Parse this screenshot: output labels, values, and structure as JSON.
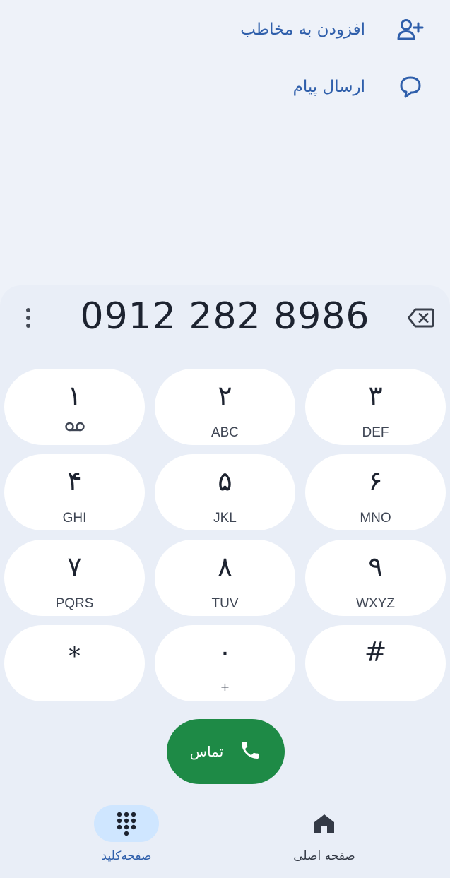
{
  "actions": {
    "add_contact": "افزودن به مخاطب",
    "send_message": "ارسال پیام"
  },
  "dialer": {
    "number": "0912 282 8986"
  },
  "keypad": [
    {
      "digit": "۱",
      "letters": "",
      "sub": "oo"
    },
    {
      "digit": "۲",
      "letters": "ABC",
      "sub": ""
    },
    {
      "digit": "۳",
      "letters": "DEF",
      "sub": ""
    },
    {
      "digit": "۴",
      "letters": "GHI",
      "sub": ""
    },
    {
      "digit": "۵",
      "letters": "JKL",
      "sub": ""
    },
    {
      "digit": "۶",
      "letters": "MNO",
      "sub": ""
    },
    {
      "digit": "۷",
      "letters": "PQRS",
      "sub": ""
    },
    {
      "digit": "۸",
      "letters": "TUV",
      "sub": ""
    },
    {
      "digit": "۹",
      "letters": "WXYZ",
      "sub": ""
    },
    {
      "digit": "*",
      "letters": "",
      "sub": ""
    },
    {
      "digit": "۰",
      "letters": "",
      "sub": "+"
    },
    {
      "digit": "#",
      "letters": "",
      "sub": ""
    }
  ],
  "call_button": {
    "label": "تماس"
  },
  "nav": {
    "keypad_label": "صفحه‌کلید",
    "home_label": "صفحه اصلی"
  },
  "colors": {
    "accent": "#2f5fab",
    "call_green": "#1e8a46",
    "active_pill": "#cfe6ff"
  },
  "icons": {
    "add_contact": "person-add-icon",
    "message": "message-icon",
    "menu": "more-vert-icon",
    "backspace": "backspace-icon",
    "phone": "phone-icon",
    "voicemail": "voicemail-icon",
    "keypad": "dialpad-icon",
    "home": "home-icon"
  }
}
